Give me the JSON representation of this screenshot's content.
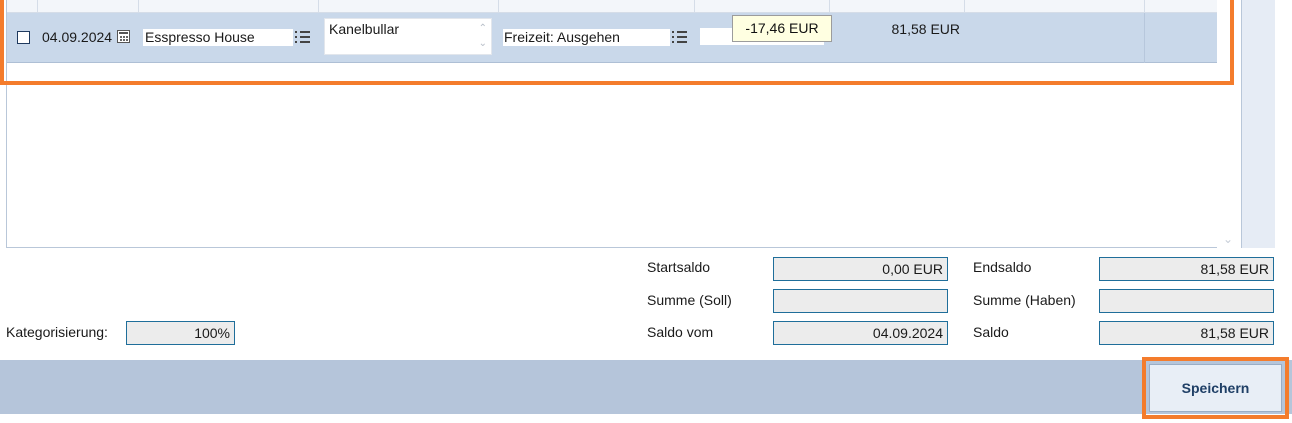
{
  "transaction": {
    "date": "04.09.2024",
    "payee": "Esspresso House",
    "memo": "Kanelbullar",
    "category": "Freizeit: Ausgehen",
    "amount_tooltip": "-17,46 EUR",
    "balance": "81,58 EUR"
  },
  "summary": {
    "startsaldo_label": "Startsaldo",
    "startsaldo_value": "0,00 EUR",
    "summe_soll_label": "Summe (Soll)",
    "summe_soll_value": "",
    "saldo_vom_label": "Saldo vom",
    "saldo_vom_value": "04.09.2024",
    "endsaldo_label": "Endsaldo",
    "endsaldo_value": "81,58 EUR",
    "summe_haben_label": "Summe (Haben)",
    "summe_haben_value": "",
    "saldo_label": "Saldo",
    "saldo_value": "81,58 EUR"
  },
  "kategorisierung": {
    "label": "Kategorisierung:",
    "value": "100%"
  },
  "footer": {
    "save_label": "Speichern"
  },
  "colors": {
    "highlight": "#f47c2c",
    "row_selected": "#c9d8ea",
    "footer_bar": "#b5c5da",
    "field_border": "#1f6e9a"
  }
}
